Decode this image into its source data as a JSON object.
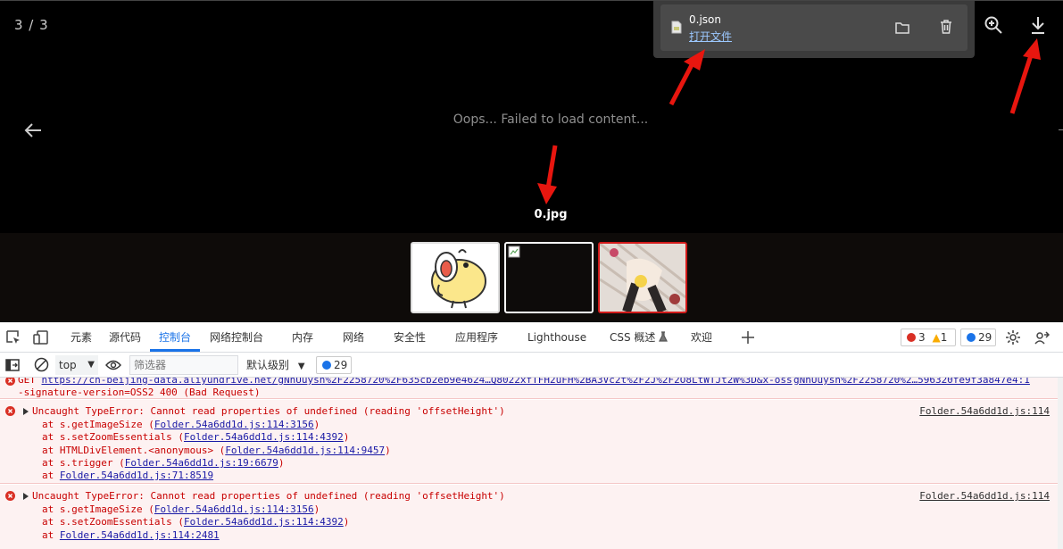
{
  "viewer": {
    "counter": "3 / 3",
    "error_message": "Oops... Failed to load content...",
    "filename": "0.jpg"
  },
  "download_popup": {
    "file_name": "0.json",
    "open_file_label": "打开文件"
  },
  "devtools": {
    "tabs": [
      "元素",
      "源代码",
      "控制台",
      "网络控制台",
      "内存",
      "网络",
      "安全性",
      "应用程序",
      "Lighthouse",
      "CSS 概述",
      "欢迎"
    ],
    "active_tab": "控制台",
    "error_count": "3",
    "warning_count": "1",
    "message_count": "29"
  },
  "console_toolbar": {
    "context": "top",
    "filter_placeholder": "筛选器",
    "level": "默认级别",
    "message_count": "29"
  },
  "console": {
    "request_line_1_prefix": "GET ",
    "request_url_left": "https://cn-beijing-data.aliyundrive.net/gNnUuysh%2F2258720%2F635cb2eb9e4624…Q8022xfTFH2uFH%2BA3Vc2t%2F2J%2F2O8LtWTJt2W%3D&x-oss",
    "request_url_right": "gNnUuysh%2F2258720%2…596320fe9f3a847e4:1",
    "request_line_2": "-signature-version=OSS2 400 (Bad Request)",
    "errors": [
      {
        "message": "Uncaught TypeError: Cannot read properties of undefined (reading 'offsetHeight')",
        "source": "Folder.54a6dd1d.js:114",
        "stack": [
          {
            "fn": "s.getImageSize",
            "loc": "Folder.54a6dd1d.js:114:3156"
          },
          {
            "fn": "s.setZoomEssentials",
            "loc": "Folder.54a6dd1d.js:114:4392"
          },
          {
            "fn": "HTMLDivElement.<anonymous>",
            "loc": "Folder.54a6dd1d.js:114:9457"
          },
          {
            "fn": "s.trigger",
            "loc": "Folder.54a6dd1d.js:19:6679"
          },
          {
            "fn": "",
            "loc": "Folder.54a6dd1d.js:71:8519"
          }
        ]
      },
      {
        "message": "Uncaught TypeError: Cannot read properties of undefined (reading 'offsetHeight')",
        "source": "Folder.54a6dd1d.js:114",
        "stack": [
          {
            "fn": "s.getImageSize",
            "loc": "Folder.54a6dd1d.js:114:3156"
          },
          {
            "fn": "s.setZoomEssentials",
            "loc": "Folder.54a6dd1d.js:114:4392"
          },
          {
            "fn": "",
            "loc": "Folder.54a6dd1d.js:114:2481"
          }
        ]
      }
    ]
  },
  "colors": {
    "error": "#c80000",
    "accent": "#1a73e8",
    "annotation_arrow": "#e8160f",
    "warning": "#f9ab00"
  }
}
